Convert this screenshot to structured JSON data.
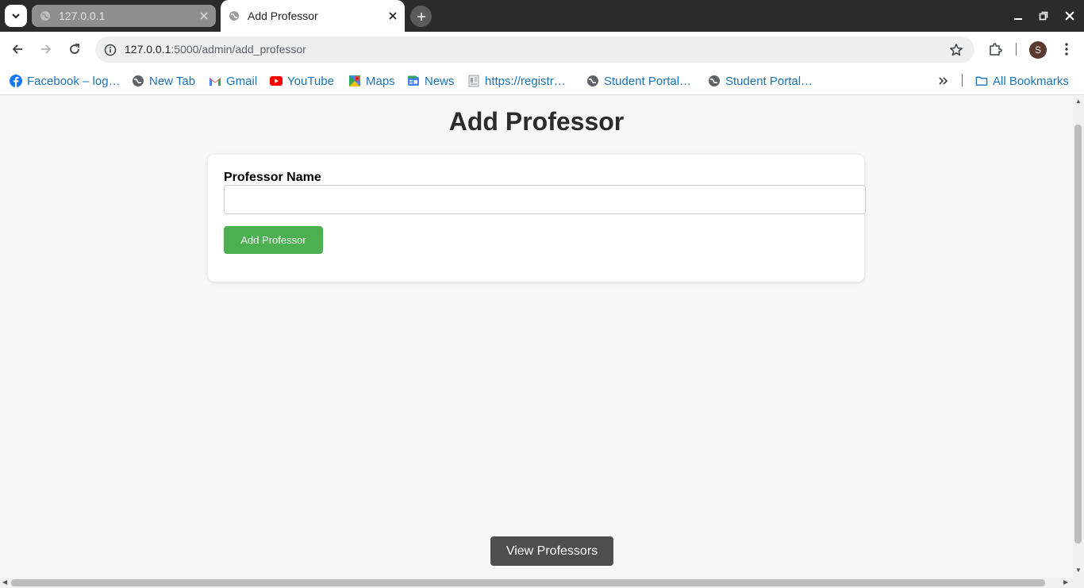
{
  "browser": {
    "tabs": [
      {
        "title": "127.0.0.1",
        "active": false
      },
      {
        "title": "Add Professor",
        "active": true
      }
    ],
    "url": {
      "host": "127.0.0.1",
      "path": ":5000/admin/add_professor"
    },
    "profile_initial": "S"
  },
  "bookmarks": {
    "items": [
      {
        "label": "Facebook – log…",
        "icon": "facebook-icon"
      },
      {
        "label": "New Tab",
        "icon": "globe-icon"
      },
      {
        "label": "Gmail",
        "icon": "gmail-icon"
      },
      {
        "label": "YouTube",
        "icon": "youtube-icon"
      },
      {
        "label": "Maps",
        "icon": "maps-icon"
      },
      {
        "label": "News",
        "icon": "news-icon"
      },
      {
        "label": "https://registr…",
        "icon": "document-icon"
      },
      {
        "label": "Student Portal…",
        "icon": "globe-icon"
      },
      {
        "label": "Student Portal…",
        "icon": "globe-icon"
      }
    ],
    "all_bookmarks_label": "All Bookmarks"
  },
  "page": {
    "title": "Add Professor",
    "form": {
      "label": "Professor Name",
      "input_value": "",
      "submit_label": "Add Professor"
    },
    "view_button_label": "View Professors"
  },
  "colors": {
    "submit_button": "#4caf50",
    "view_button": "#4e4e4e",
    "bookmark_text": "#1a73b8"
  }
}
